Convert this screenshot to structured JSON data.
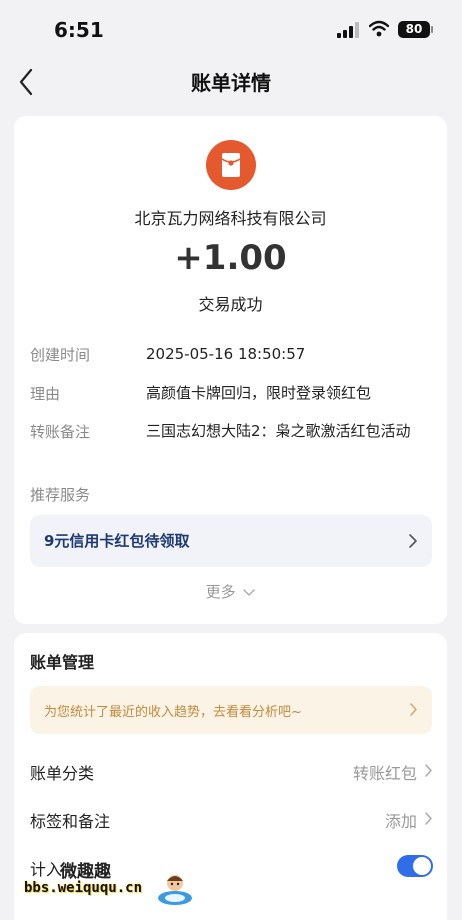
{
  "status_bar": {
    "time": "6:51",
    "battery": "80"
  },
  "nav": {
    "title": "账单详情"
  },
  "transaction": {
    "payee": "北京瓦力网络科技有限公司",
    "amount": "+1.00",
    "status": "交易成功"
  },
  "details": [
    {
      "label": "创建时间",
      "value": "2025-05-16 18:50:57"
    },
    {
      "label": "理由",
      "value": "高颜值卡牌回归，限时登录领红包"
    },
    {
      "label": "转账备注",
      "value": "三国志幻想大陆2：枭之歌激活红包活动"
    }
  ],
  "recommend": {
    "label": "推荐服务",
    "promo": "9元信用卡红包待领取",
    "more": "更多"
  },
  "management": {
    "title": "账单管理",
    "insight": "为您统计了最近的收入趋势，去看看分析吧~",
    "category_label": "账单分类",
    "category_value": "转账红包",
    "tag_label": "标签和备注",
    "tag_value": "添加",
    "include_label": "计入",
    "include_on": true
  },
  "watermark": {
    "site": "微趣趣",
    "url": "bbs.weiququ.cn"
  },
  "colors": {
    "accent": "#2f6ee8",
    "payee_avatar": "#e45a2e",
    "insight_text": "#c28a3e"
  }
}
